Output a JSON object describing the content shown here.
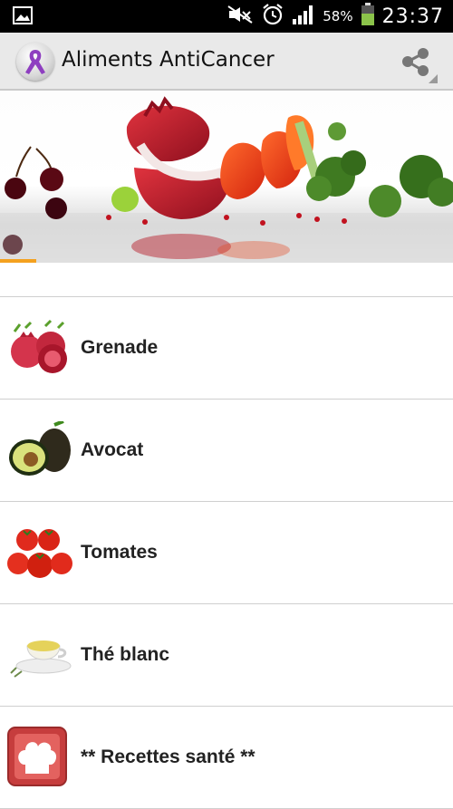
{
  "status_bar": {
    "battery": "58%",
    "time": "23:37",
    "icons": [
      "image-icon",
      "mute-icon",
      "alarm-icon",
      "signal-icon",
      "battery-icon"
    ]
  },
  "action_bar": {
    "title": "Aliments AntiCancer",
    "logo_icon": "purple-ribbon-icon",
    "share_icon": "share-icon"
  },
  "list": {
    "items": [
      {
        "label": "Grenade",
        "icon": "pomegranate-icon"
      },
      {
        "label": "Avocat",
        "icon": "avocado-icon"
      },
      {
        "label": "Tomates",
        "icon": "tomatoes-icon"
      },
      {
        "label": "Thé blanc",
        "icon": "tea-cup-icon"
      },
      {
        "label": "** Recettes santé **",
        "icon": "chef-hat-icon"
      }
    ]
  },
  "colors": {
    "status_bar": "#000000",
    "action_bar": "#e9e9e9",
    "ribbon": "#8e3fc0",
    "battery": "#8bc34a"
  }
}
